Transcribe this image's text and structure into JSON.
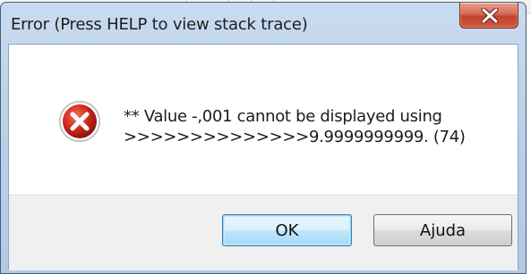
{
  "dialog": {
    "title": "Error (Press HELP to view stack trace)",
    "close_icon": "close-icon",
    "error_icon": "error-icon",
    "message_line1": "** Value -,001 cannot be displayed using",
    "message_line2": ">>>>>>>>>>>>>>9.9999999999. (74)",
    "buttons": {
      "ok_label": "OK",
      "help_label": "Ajuda"
    }
  },
  "colors": {
    "close_button": "#c3412a",
    "error_icon_red": "#c8241c",
    "titlebar": "#bcd1ea",
    "default_button_border": "#3c7fb1"
  }
}
